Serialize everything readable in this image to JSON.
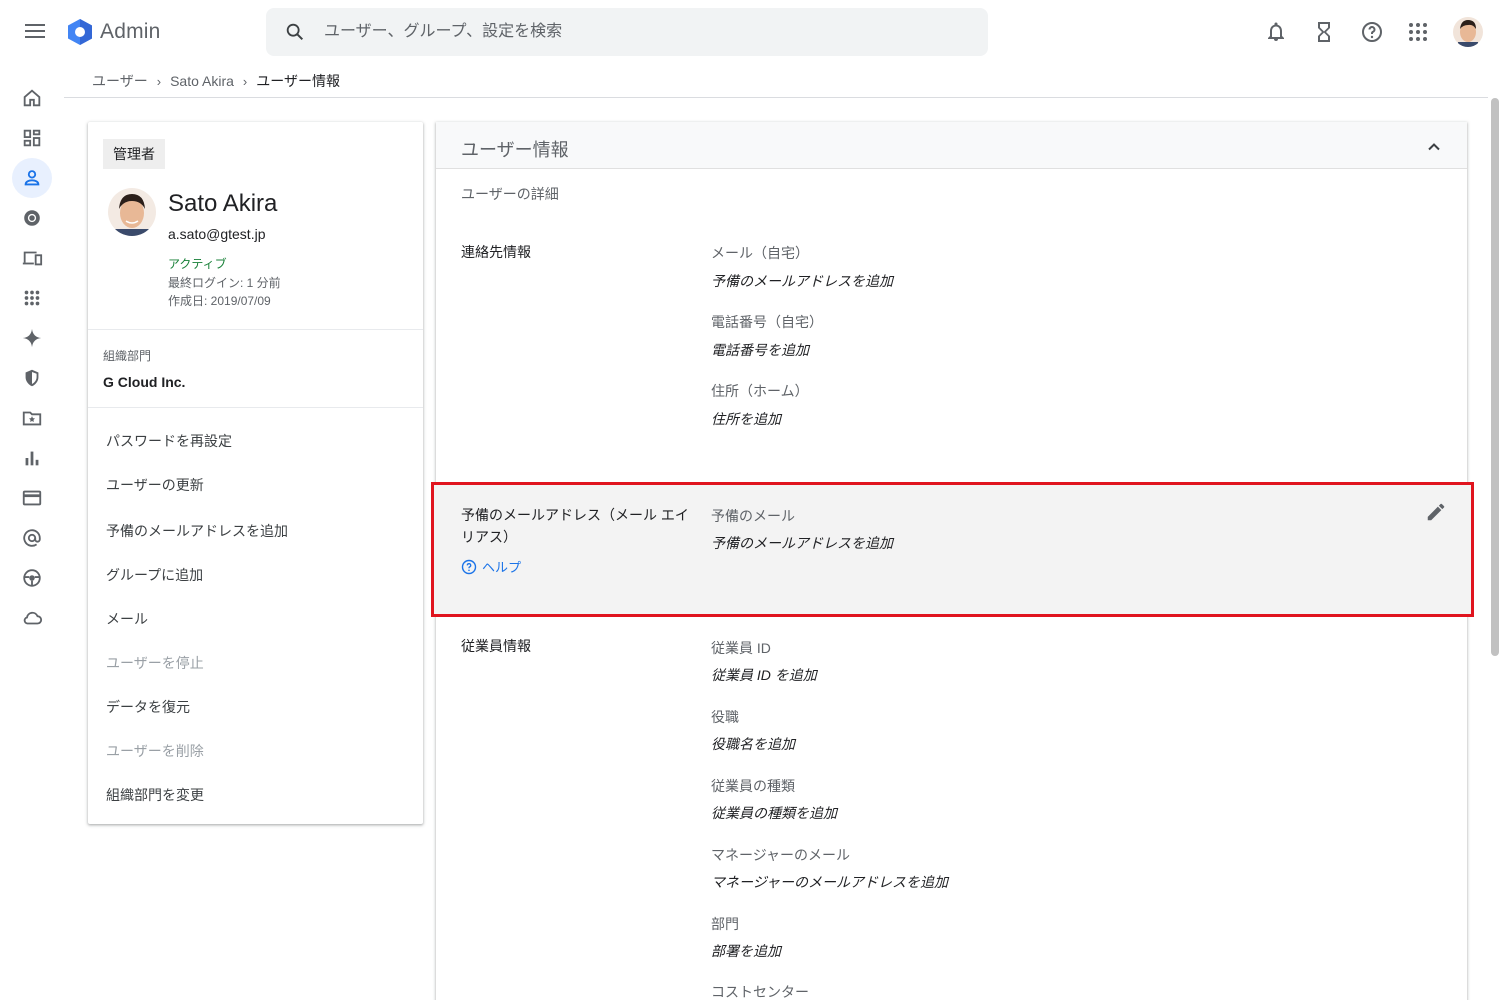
{
  "header": {
    "app_title": "Admin",
    "search_placeholder": "ユーザー、グループ、設定を検索",
    "icons": [
      "menu-icon",
      "admin-logo-icon",
      "search-icon",
      "notifications-icon",
      "tasks-hourglass-icon",
      "help-icon",
      "apps-grid-icon"
    ]
  },
  "rail": {
    "items": [
      "home",
      "dashboard",
      "users",
      "chrome",
      "devices",
      "apps",
      "gemini",
      "security",
      "storage",
      "reports",
      "billing",
      "account",
      "rules",
      "cloud"
    ],
    "active": "users"
  },
  "breadcrumb": {
    "items": [
      "ユーザー",
      "Sato Akira"
    ],
    "current": "ユーザー情報"
  },
  "user_card": {
    "role": "管理者",
    "name": "Sato Akira",
    "email": "a.sato@gtest.jp",
    "status": "アクティブ",
    "last_login": "最終ログイン: 1 分前",
    "created": "作成日: 2019/07/09",
    "org_label": "組織部門",
    "org_value": "G Cloud Inc.",
    "actions": [
      {
        "label": "パスワードを再設定",
        "enabled": true
      },
      {
        "label": "ユーザーの更新",
        "enabled": true
      },
      {
        "label": "予備のメールアドレスを追加",
        "enabled": true
      },
      {
        "label": "グループに追加",
        "enabled": true
      },
      {
        "label": "メール",
        "enabled": true
      },
      {
        "label": "ユーザーを停止",
        "enabled": false
      },
      {
        "label": "データを復元",
        "enabled": true
      },
      {
        "label": "ユーザーを削除",
        "enabled": false
      },
      {
        "label": "組織部門を変更",
        "enabled": true
      }
    ]
  },
  "info_panel": {
    "title": "ユーザー情報",
    "subtitle": "ユーザーの詳細",
    "contact": {
      "label": "連絡先情報",
      "fields": [
        {
          "label": "メール（自宅）",
          "value": "予備のメールアドレスを追加"
        },
        {
          "label": "電話番号（自宅）",
          "value": "電話番号を追加"
        },
        {
          "label": "住所（ホーム）",
          "value": "住所を追加"
        }
      ]
    },
    "alias": {
      "label": "予備のメールアドレス（メール エイリアス）",
      "help": "ヘルプ",
      "field_label": "予備のメール",
      "field_value": "予備のメールアドレスを追加",
      "highlight_color": "#e0141e"
    },
    "employee": {
      "label": "従業員情報",
      "fields": [
        {
          "label": "従業員 ID",
          "value": "従業員 ID を追加"
        },
        {
          "label": "役職",
          "value": "役職名を追加"
        },
        {
          "label": "従業員の種類",
          "value": "従業員の種類を追加"
        },
        {
          "label": "マネージャーのメール",
          "value": "マネージャーのメールアドレスを追加"
        },
        {
          "label": "部門",
          "value": "部署を追加"
        },
        {
          "label": "コストセンター",
          "value": ""
        }
      ]
    }
  },
  "colors": {
    "accent": "#1a73e8",
    "active_status": "#188038",
    "highlight": "#e0141e"
  }
}
